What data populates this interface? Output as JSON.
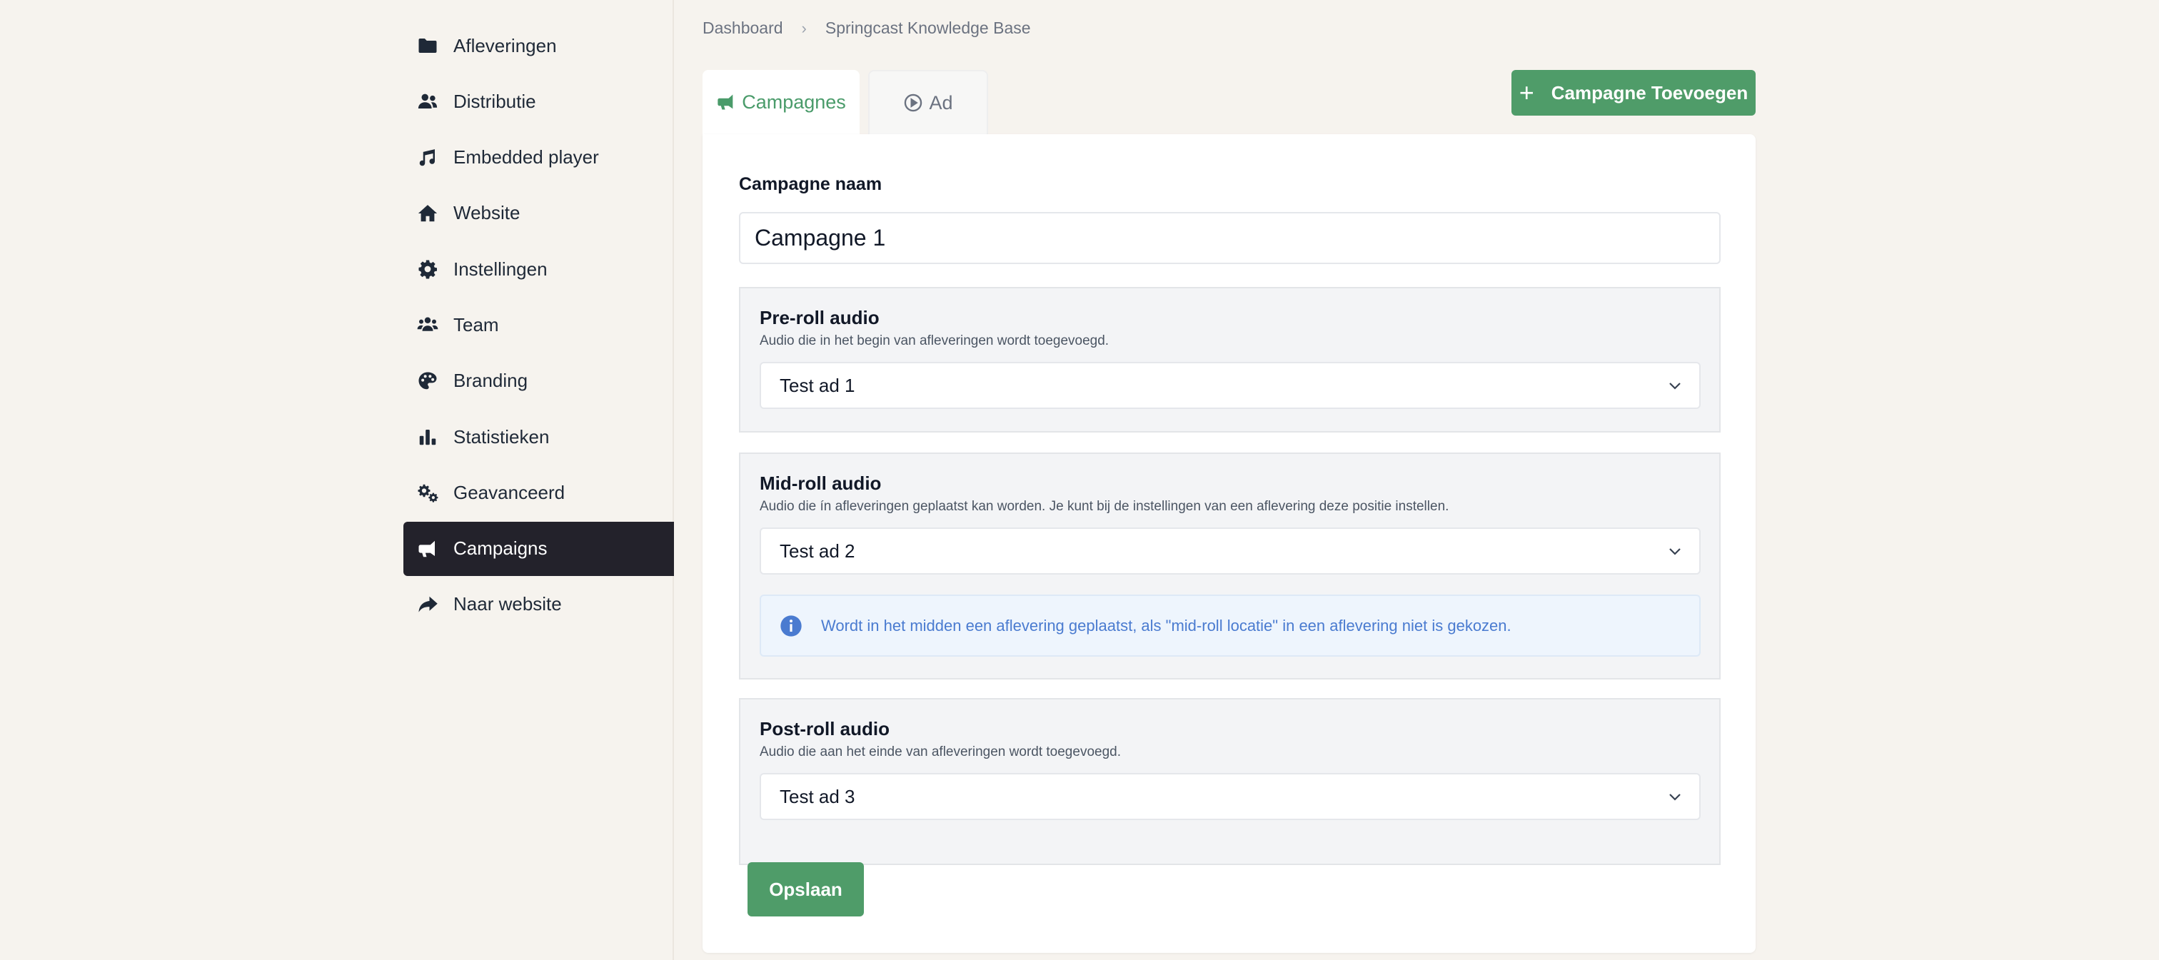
{
  "breadcrumb": {
    "items": [
      "Dashboard",
      "Springcast Knowledge Base"
    ],
    "separator": "›"
  },
  "sidebar": {
    "items": [
      {
        "label": "Afleveringen",
        "icon": "folder-icon",
        "active": false
      },
      {
        "label": "Distributie",
        "icon": "users-icon",
        "active": false
      },
      {
        "label": "Embedded player",
        "icon": "music-icon",
        "active": false
      },
      {
        "label": "Website",
        "icon": "home-icon",
        "active": false
      },
      {
        "label": "Instellingen",
        "icon": "gear-icon",
        "active": false
      },
      {
        "label": "Team",
        "icon": "team-icon",
        "active": false
      },
      {
        "label": "Branding",
        "icon": "palette-icon",
        "active": false
      },
      {
        "label": "Statistieken",
        "icon": "bar-chart-icon",
        "active": false
      },
      {
        "label": "Geavanceerd",
        "icon": "gears-icon",
        "active": false
      },
      {
        "label": "Campaigns",
        "icon": "megaphone-icon",
        "active": true
      },
      {
        "label": "Naar website",
        "icon": "share-icon",
        "active": false
      }
    ]
  },
  "tabs": [
    {
      "label": "Campagnes",
      "icon": "megaphone-icon",
      "active": true
    },
    {
      "label": "Ad",
      "icon": "play-circle-icon",
      "active": false
    }
  ],
  "actions": {
    "add_label": "Campagne Toevoegen",
    "add_icon": "plus-icon",
    "save_label": "Opslaan"
  },
  "form": {
    "name_label": "Campagne naam",
    "name_value": "Campagne 1",
    "preroll": {
      "title": "Pre-roll audio",
      "description": "Audio die in het begin van afleveringen wordt toegevoegd.",
      "selected": "Test ad 1"
    },
    "midroll": {
      "title": "Mid-roll audio",
      "description": "Audio die ín afleveringen geplaatst kan worden. Je kunt bij de instellingen van een aflevering deze positie instellen.",
      "selected": "Test ad 2",
      "info": "Wordt in het midden een aflevering geplaatst, als \"mid-roll locatie\" in een aflevering niet is gekozen."
    },
    "postroll": {
      "title": "Post-roll audio",
      "description": "Audio die aan het einde van afleveringen wordt toegevoegd.",
      "selected": "Test ad 3"
    }
  },
  "colors": {
    "accent": "#4f9c69",
    "sidebar_active": "#23222b",
    "background": "#f6f3ee",
    "info_text": "#4a7bd0"
  }
}
